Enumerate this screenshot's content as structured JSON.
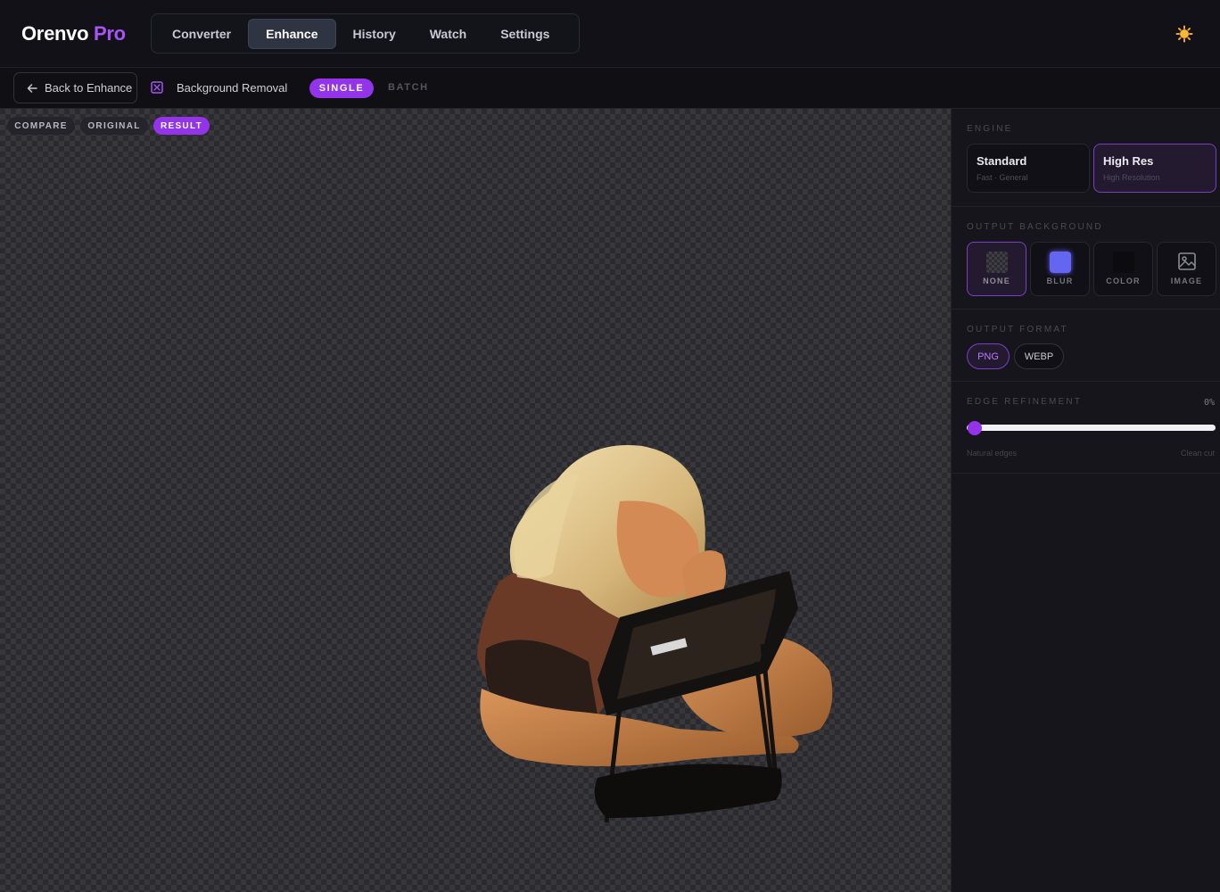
{
  "brand": {
    "name": "Orenvo",
    "suffix": "Pro"
  },
  "nav": {
    "tabs": [
      "Converter",
      "Enhance",
      "History",
      "Watch",
      "Settings"
    ],
    "active": "Enhance"
  },
  "subbar": {
    "back_label": "Back to Enhance",
    "tool_title": "Background Removal",
    "mode_single": "SINGLE",
    "mode_batch": "BATCH"
  },
  "view": {
    "compare": "COMPARE",
    "original": "ORIGINAL",
    "result": "RESULT",
    "active": "RESULT"
  },
  "panel": {
    "engine": {
      "label": "ENGINE",
      "options": [
        {
          "name": "Standard",
          "sub": "Fast · General"
        },
        {
          "name": "High Res",
          "sub": "High Resolution"
        }
      ],
      "selected": "High Res"
    },
    "background": {
      "label": "OUTPUT BACKGROUND",
      "options": [
        "NONE",
        "BLUR",
        "COLOR",
        "IMAGE"
      ],
      "selected": "NONE"
    },
    "format": {
      "label": "OUTPUT FORMAT",
      "options": [
        "PNG",
        "WEBP"
      ],
      "selected": "PNG"
    },
    "edge": {
      "label": "EDGE REFINEMENT",
      "value_text": "0%",
      "value": 0,
      "min_label": "Natural edges",
      "max_label": "Clean cut"
    }
  },
  "colors": {
    "accent": "#9333ea",
    "accent_border": "#7a3fc4",
    "sun": "#f5a623"
  },
  "icons": {
    "back": "arrow-left-icon",
    "tool": "background-removal-icon",
    "theme": "sun-icon",
    "image": "image-icon"
  }
}
